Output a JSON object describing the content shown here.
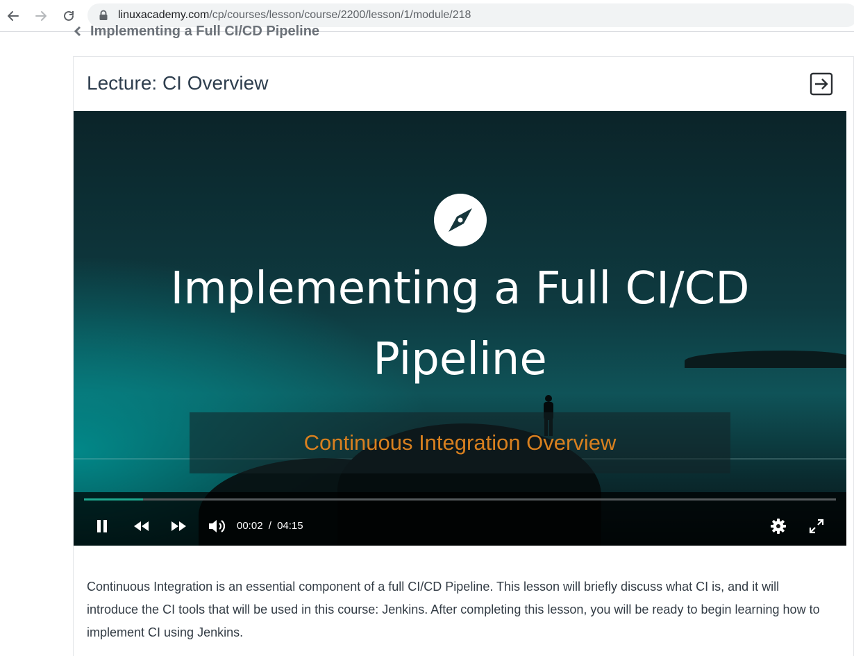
{
  "browser": {
    "url_host": "linuxacademy.com",
    "url_path": "/cp/courses/lesson/course/2200/lesson/1/module/218"
  },
  "breadcrumb": {
    "label": "Implementing a Full CI/CD Pipeline"
  },
  "lecture": {
    "title": "Lecture: CI Overview"
  },
  "video": {
    "slide_title_line1": "Implementing a Full CI/CD",
    "slide_title_line2": "Pipeline",
    "slide_subtitle": "Continuous Integration Overview",
    "current_time": "00:02",
    "time_separator": "/",
    "duration": "04:15",
    "progress_fraction": 0.0078
  },
  "description": {
    "text": "Continuous Integration is an essential component of a full CI/CD Pipeline. This lesson will briefly discuss what CI is, and it will introduce the CI tools that will be used in this course: Jenkins. After completing this lesson, you will be ready to begin learning how to implement CI using Jenkins."
  },
  "colors": {
    "subtitle": "#d9801f",
    "progress": "#1fa88f",
    "title_text": "#2e3e4e"
  },
  "icons": {
    "back": "arrow-left-icon",
    "forward": "arrow-right-icon",
    "reload": "reload-icon",
    "lock": "lock-icon",
    "exit": "exit-arrow-icon",
    "compass": "compass-icon",
    "pause": "pause-icon",
    "rewind": "rewind-icon",
    "fast_forward": "fast-forward-icon",
    "volume": "volume-icon",
    "settings": "gear-icon",
    "fullscreen": "fullscreen-icon"
  }
}
